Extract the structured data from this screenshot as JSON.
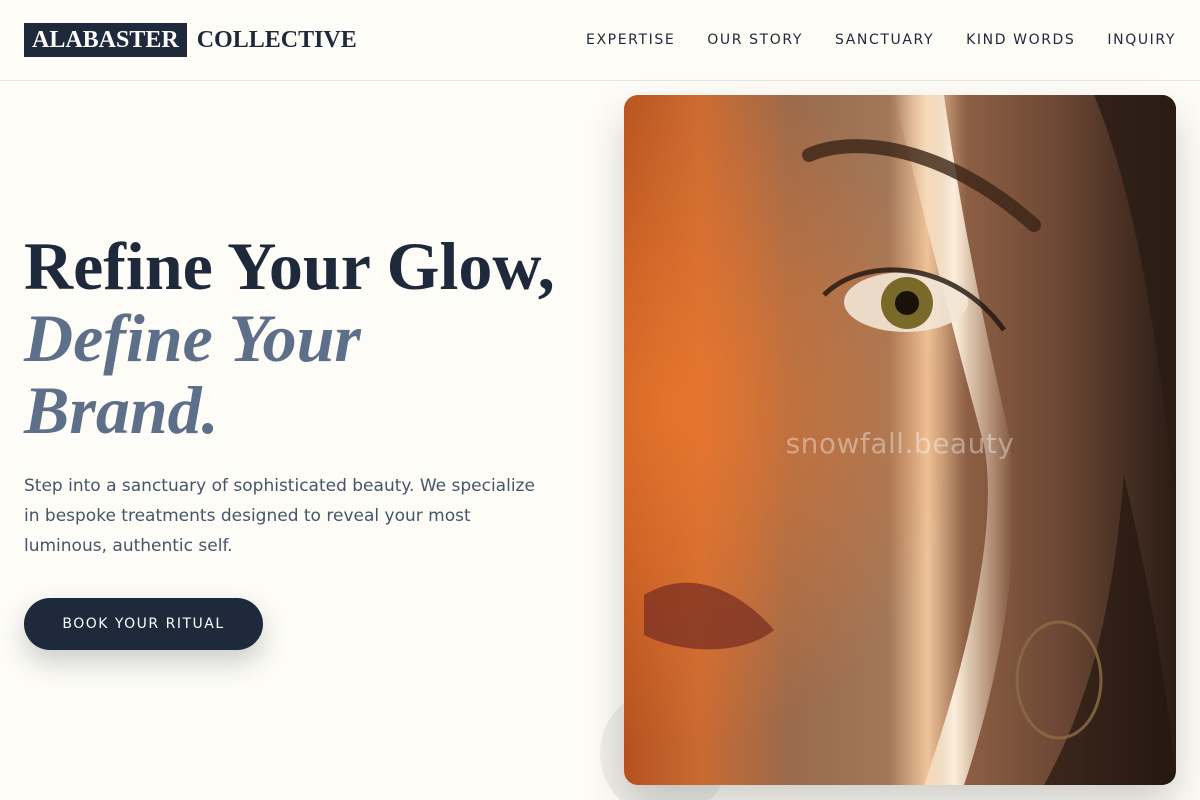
{
  "brand": {
    "boxed": "ALABASTER",
    "rest": "COLLECTIVE"
  },
  "nav": [
    {
      "label": "EXPERTISE"
    },
    {
      "label": "OUR STORY"
    },
    {
      "label": "SANCTUARY"
    },
    {
      "label": "KIND WORDS"
    },
    {
      "label": "INQUIRY"
    }
  ],
  "hero": {
    "title_line1": "Refine Your Glow,",
    "title_line2": "Define Your",
    "title_line3": "Brand.",
    "description": "Step into a sanctuary of sophisticated beauty. We specialize in bespoke treatments designed to reveal your most luminous, authentic self.",
    "cta_label": "BOOK YOUR RITUAL",
    "image_watermark": "snowfall.beauty"
  },
  "colors": {
    "primary": "#1e293b",
    "accent": "#5e6f8a",
    "background": "#fdfcf6"
  }
}
